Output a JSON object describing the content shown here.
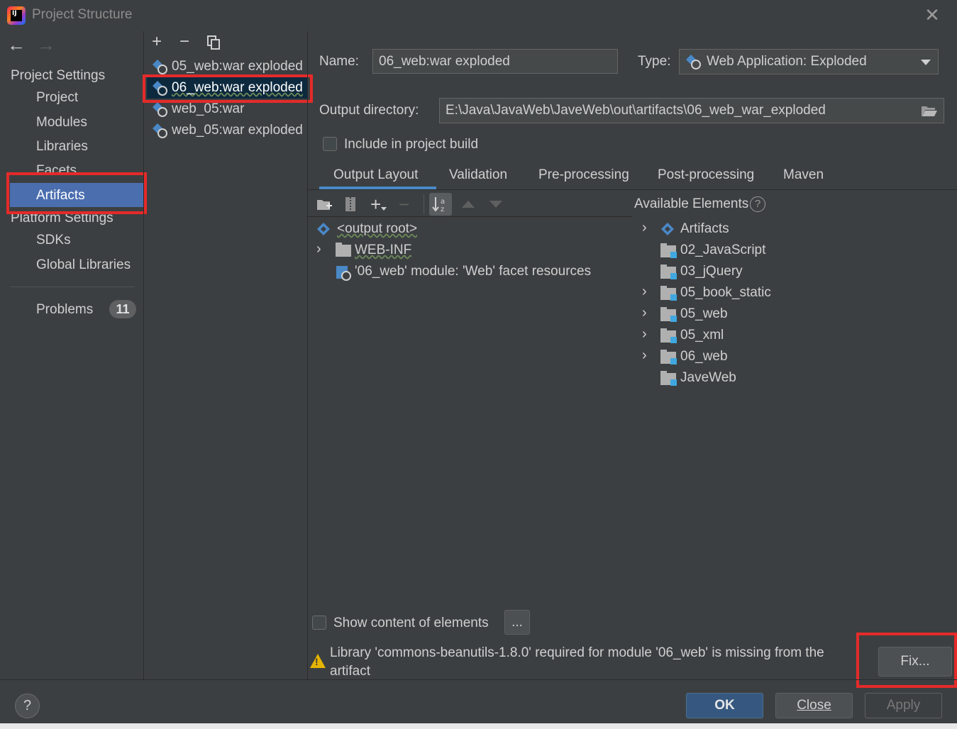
{
  "window": {
    "title": "Project Structure"
  },
  "sidebar": {
    "project_settings_header": "Project Settings",
    "project_items": [
      "Project",
      "Modules",
      "Libraries",
      "Facets",
      "Artifacts"
    ],
    "selected": "Artifacts",
    "platform_settings_header": "Platform Settings",
    "platform_items": [
      "SDKs",
      "Global Libraries"
    ],
    "problems_label": "Problems",
    "problems_count": "11"
  },
  "artifact_list": {
    "items": [
      "05_web:war exploded",
      "06_web:war exploded",
      "web_05:war",
      "web_05:war exploded"
    ],
    "selected_index": 1
  },
  "form": {
    "name_label": "Name:",
    "name_value": "06_web:war exploded",
    "type_label": "Type:",
    "type_value": "Web Application: Exploded",
    "output_dir_label": "Output directory:",
    "output_dir_value": "E:\\Java\\JavaWeb\\JaveWeb\\out\\artifacts\\06_web_war_exploded",
    "include_build_label": "Include in project build"
  },
  "tabs": [
    "Output Layout",
    "Validation",
    "Pre-processing",
    "Post-processing",
    "Maven"
  ],
  "active_tab": "Output Layout",
  "output_tree": {
    "root": "<output root>",
    "web_inf": "WEB-INF",
    "facet_resources": "'06_web' module: 'Web' facet resources"
  },
  "available_elements": {
    "header": "Available Elements",
    "items": [
      "Artifacts",
      "02_JavaScript",
      "03_jQuery",
      "05_book_static",
      "05_web",
      "05_xml",
      "06_web",
      "JaveWeb"
    ]
  },
  "bottom": {
    "show_content_label": "Show content of elements",
    "ellipsis_button": "...",
    "warning_line1": "Library 'commons-beanutils-1.8.0' required for module '06_web' is missing from the",
    "warning_line2": "artifact",
    "fix_button": "Fix...",
    "help_button": "?",
    "ok_button": "OK",
    "close_button": "Close",
    "apply_button": "Apply"
  },
  "colors": {
    "background": "#3c3f41",
    "selection": "#4b6eaf",
    "list_selection": "#0d293e",
    "highlight_red": "#e52a2a",
    "primary_button": "#365880"
  }
}
